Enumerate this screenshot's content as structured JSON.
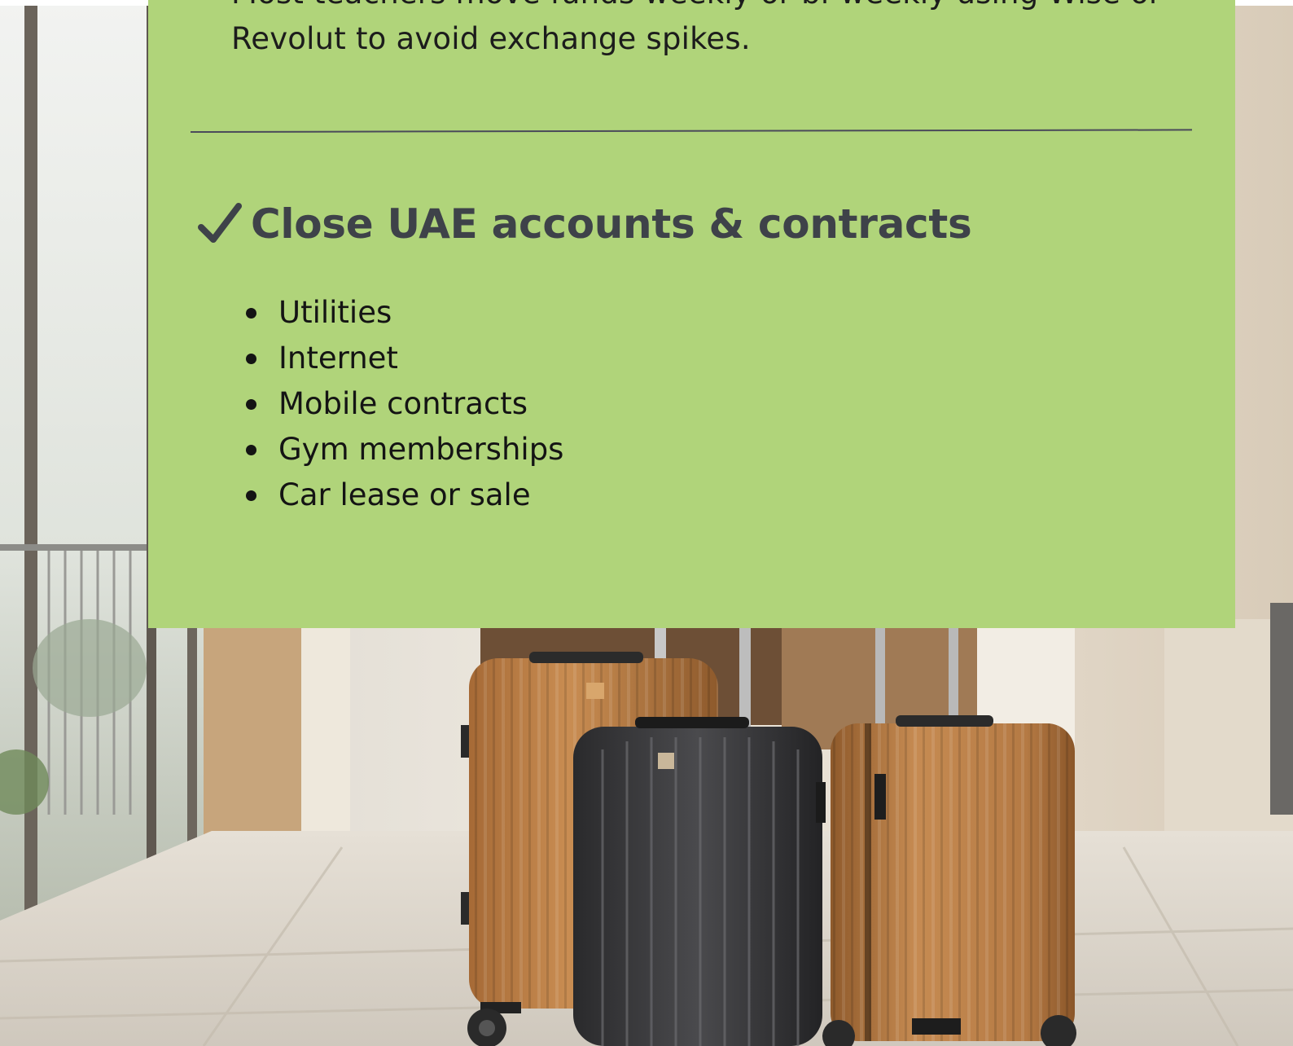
{
  "article": {
    "intro_text": "Most teachers move funds weekly or bi-weekly using Wise or Revolut to avoid exchange spikes.",
    "section": {
      "check_icon": "checkmark-icon",
      "heading": "Close UAE accounts & contracts",
      "items": [
        {
          "label": "Utilities"
        },
        {
          "label": "Internet"
        },
        {
          "label": "Mobile contracts"
        },
        {
          "label": "Gym memberships"
        },
        {
          "label": "Car lease or sale"
        }
      ]
    }
  },
  "colors": {
    "card_background": "#b0d47a",
    "heading_text": "#3e4249",
    "body_text": "#141414",
    "divider": "#4a4a5a"
  },
  "background_image": {
    "description_icon": "suitcases-photo"
  }
}
